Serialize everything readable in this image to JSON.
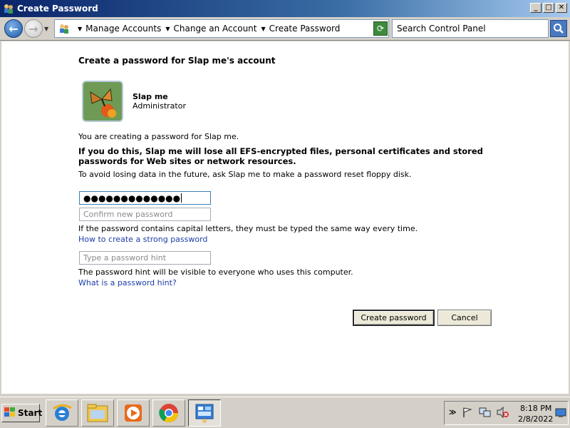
{
  "window": {
    "title": "Create Password",
    "buttons": {
      "minimize": "_",
      "maximize": "□",
      "close": "✕"
    }
  },
  "address_bar": {
    "breadcrumbs": [
      "Manage Accounts",
      "Change an Account",
      "Create Password"
    ],
    "search_placeholder": "Search Control Panel"
  },
  "main": {
    "heading": "Create a password for Slap me's account",
    "user": {
      "name": "Slap me",
      "role": "Administrator"
    },
    "info_text": "You are creating a password for Slap me.",
    "warning_text": "If you do this, Slap me will lose all EFS-encrypted files, personal certificates and stored passwords for Web sites or network resources.",
    "advice_text": "To avoid losing data in the future, ask Slap me to make a password reset floppy disk.",
    "new_password_value": "●●●●●●●●●●●●●",
    "confirm_placeholder": "Confirm new password",
    "case_text": "If the password contains capital letters, they must be typed the same way every time.",
    "strong_password_link": "How to create a strong password",
    "hint_placeholder": "Type a password hint",
    "hint_text": "The password hint will be visible to everyone who uses this computer.",
    "hint_link": "What is a password hint?",
    "create_button": "Create password",
    "cancel_button": "Cancel"
  },
  "taskbar": {
    "start_label": "Start",
    "apps": [
      "internet-explorer-icon",
      "file-explorer-icon",
      "media-player-icon",
      "chrome-icon",
      "control-panel-icon"
    ],
    "clock_time": "8:18 PM",
    "clock_date": "2/8/2022"
  }
}
